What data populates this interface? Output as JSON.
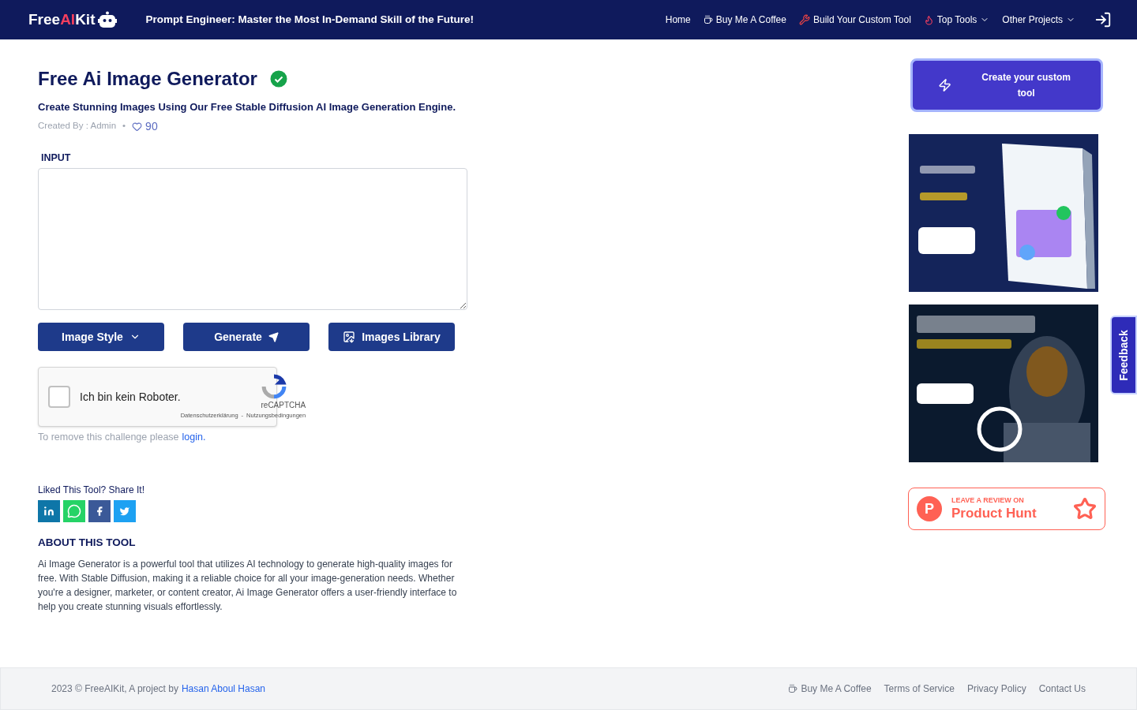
{
  "header": {
    "logo": {
      "before": "Free",
      "accent": "AI",
      "after": "Kit"
    },
    "headline": "Prompt Engineer: Master the Most In-Demand Skill of the Future!",
    "nav": [
      {
        "label": "Home",
        "kind": "plain",
        "dropdown": false
      },
      {
        "label": "Buy Me A Coffee",
        "kind": "coffee",
        "dropdown": false
      },
      {
        "label": "Build Your Custom Tool",
        "kind": "tools",
        "dropdown": false
      },
      {
        "label": "Top Tools",
        "kind": "fire",
        "dropdown": true
      },
      {
        "label": "Other Projects",
        "kind": "plain",
        "dropdown": true
      }
    ]
  },
  "tool": {
    "title": "Free Ai Image Generator",
    "verified": true,
    "subtitle": "Create Stunning Images Using Our Free Stable Diffusion AI Image Generation Engine.",
    "created_by": "Created By : Admin",
    "separator": "•",
    "likes": "90",
    "input_label": "INPUT",
    "buttons": [
      {
        "label": "Image Style",
        "kind": "dropdown"
      },
      {
        "label": "Generate",
        "kind": "send"
      },
      {
        "label": "Images Library",
        "kind": "library"
      }
    ],
    "captcha": {
      "label": "Ich bin kein Roboter.",
      "checked": false,
      "brand": "reCAPTCHA",
      "privacy": "Datenschutzerklärung",
      "sep": "-",
      "terms": "Nutzungsbedingungen"
    },
    "challenge_text": "To remove this challenge please",
    "challenge_link": "login.",
    "share_label": "Liked This Tool? Share It!",
    "share": [
      {
        "kind": "linkedin",
        "color": "#0e76a8"
      },
      {
        "kind": "whatsapp",
        "color": "#25d366"
      },
      {
        "kind": "facebook",
        "color": "#3b5998"
      },
      {
        "kind": "twitter",
        "color": "#1da1f2"
      }
    ],
    "about_title": "ABOUT THIS TOOL",
    "about_text": "Ai Image Generator is a powerful tool that utilizes AI technology to generate high-quality images for free. With Stable Diffusion, making it a reliable choice for all your image-generation needs. Whether you're a designer, marketer, or content creator, Ai Image Generator offers a user-friendly interface to help you create stunning visuals effortlessly."
  },
  "sidebar": {
    "cta": "Create your custom tool",
    "review": {
      "small": "LEAVE A REVIEW ON",
      "big": "Product Hunt",
      "letter": "P"
    }
  },
  "feedback": "Feedback",
  "footer": {
    "copyright": "2023 © FreeAIKit, A project by",
    "author": "Hasan Aboul Hasan",
    "links": [
      {
        "label": "Buy Me A Coffee",
        "kind": "coffee"
      },
      {
        "label": "Terms of Service",
        "kind": "plain"
      },
      {
        "label": "Privacy Policy",
        "kind": "plain"
      },
      {
        "label": "Contact Us",
        "kind": "plain"
      }
    ]
  }
}
